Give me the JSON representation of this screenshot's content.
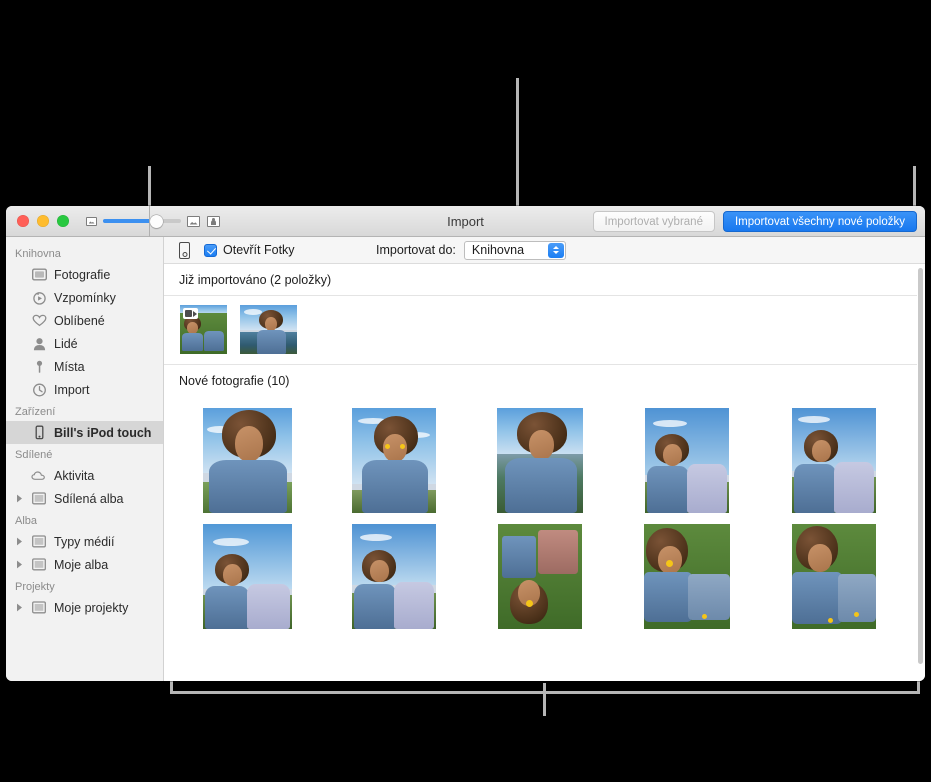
{
  "window": {
    "title": "Import",
    "traffic_lights": [
      "close",
      "minimize",
      "zoom"
    ],
    "zoom_slider": {
      "small_icon": "small-thumbnail-icon",
      "large_icon": "large-thumbnail-icon",
      "value_percent": 66
    },
    "toolbar": {
      "import_selected_label": "Importovat vybrané",
      "import_selected_enabled": false,
      "import_all_new_label": "Importovat všechny nové položky",
      "accent_color": "#1878ef"
    }
  },
  "sidebar": {
    "groups": [
      {
        "title": "Knihovna",
        "items": [
          {
            "label": "Fotografie",
            "icon": "photos-icon",
            "disclosure": false,
            "selected": false
          },
          {
            "label": "Vzpomínky",
            "icon": "memories-icon",
            "disclosure": false,
            "selected": false
          },
          {
            "label": "Oblíbené",
            "icon": "heart-icon",
            "disclosure": false,
            "selected": false
          },
          {
            "label": "Lidé",
            "icon": "person-icon",
            "disclosure": false,
            "selected": false
          },
          {
            "label": "Místa",
            "icon": "pin-icon",
            "disclosure": false,
            "selected": false
          },
          {
            "label": "Import",
            "icon": "clock-icon",
            "disclosure": false,
            "selected": false
          }
        ]
      },
      {
        "title": "Zařízení",
        "items": [
          {
            "label": "Bill's iPod touch",
            "icon": "ipod-icon",
            "disclosure": false,
            "selected": true
          }
        ]
      },
      {
        "title": "Sdílené",
        "items": [
          {
            "label": "Aktivita",
            "icon": "cloud-icon",
            "disclosure": false,
            "selected": false
          },
          {
            "label": "Sdílená alba",
            "icon": "album-icon",
            "disclosure": true,
            "selected": false
          }
        ]
      },
      {
        "title": "Alba",
        "items": [
          {
            "label": "Typy médií",
            "icon": "album-icon",
            "disclosure": true,
            "selected": false
          },
          {
            "label": "Moje alba",
            "icon": "album-icon",
            "disclosure": true,
            "selected": false
          }
        ]
      },
      {
        "title": "Projekty",
        "items": [
          {
            "label": "Moje projekty",
            "icon": "album-icon",
            "disclosure": true,
            "selected": false
          }
        ]
      }
    ]
  },
  "import_bar": {
    "device_icon": "ipod-icon",
    "open_photos_label": "Otevřít Fotky",
    "open_photos_checked": true,
    "import_into_label": "Importovat do:",
    "import_into_value": "Knihovna"
  },
  "sections": [
    {
      "heading": "Již importováno (2 položky)",
      "count": 2,
      "items": [
        {
          "kind": "video",
          "badge": "video-badge",
          "scene": "two-girls-grass"
        },
        {
          "kind": "photo",
          "badge": null,
          "scene": "girl-ocean"
        }
      ]
    },
    {
      "heading": "Nové fotografie (10)",
      "count": 10,
      "items": [
        {
          "kind": "photo",
          "scene": "girl-looking-up"
        },
        {
          "kind": "photo",
          "scene": "girl-flowers-eyes"
        },
        {
          "kind": "photo",
          "scene": "girl-ocean-smile"
        },
        {
          "kind": "photo",
          "scene": "two-girls-sky"
        },
        {
          "kind": "photo",
          "scene": "two-girls-sunglasses"
        },
        {
          "kind": "photo",
          "scene": "two-girls-field"
        },
        {
          "kind": "photo",
          "scene": "two-girls-peace"
        },
        {
          "kind": "photo",
          "scene": "girls-lying-grass-top"
        },
        {
          "kind": "photo",
          "scene": "girls-lying-grass-flower"
        },
        {
          "kind": "photo",
          "scene": "girls-lying-grass-pair"
        }
      ]
    }
  ],
  "callouts": [
    {
      "name": "sidebar-callout",
      "target": "imported-section"
    },
    {
      "name": "import-into-callout",
      "target": "import-into-popup"
    },
    {
      "name": "import-all-callout",
      "target": "import-all-new-button"
    },
    {
      "name": "new-photos-callout",
      "target": "new-photos-grid"
    }
  ]
}
